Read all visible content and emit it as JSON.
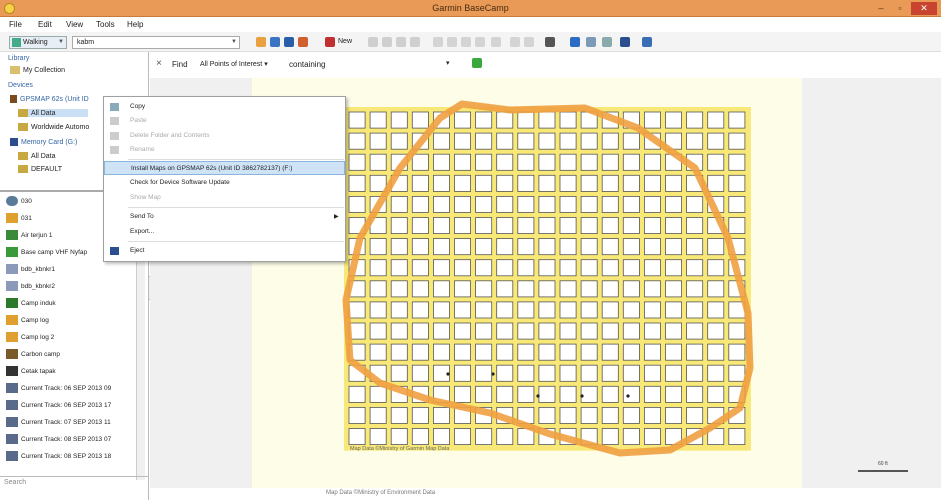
{
  "window": {
    "title": "Garmin BaseCamp",
    "min": "–",
    "max": "▫",
    "close": "✕"
  },
  "menu": [
    "File",
    "Edit",
    "View",
    "Tools",
    "Help"
  ],
  "toolbar": {
    "profile": "Walking",
    "activity": "kabm",
    "new_label": "New"
  },
  "sidebar": {
    "library_heading": "Library",
    "my_collection": "My Collection",
    "devices_heading": "Devices",
    "device_name": "GPSMAP 62s (Unit ID",
    "all_data": "All Data",
    "worldwide": "Worldwide Automo",
    "memory_card": "Memory Card (G:)",
    "card_all_data": "All Data",
    "card_default": "DEFAULT"
  },
  "list_items": [
    {
      "label": "030",
      "icon": "waypoint-icon"
    },
    {
      "label": "031",
      "icon": "cross-marker-icon"
    },
    {
      "label": "Air terjun 1",
      "icon": "waterfall-icon"
    },
    {
      "label": "Base camp VHF Nyfap",
      "icon": "flag-icon"
    },
    {
      "label": "bdb_kbnkr1",
      "icon": "vehicle-icon"
    },
    {
      "label": "bdb_kbnkr2",
      "icon": "vehicle-icon"
    },
    {
      "label": "Camp induk",
      "icon": "tent-icon"
    },
    {
      "label": "Camp log",
      "icon": "cross-marker-icon"
    },
    {
      "label": "Camp log 2",
      "icon": "cross-marker-icon"
    },
    {
      "label": "Carbon camp",
      "icon": "tree-icon"
    },
    {
      "label": "Cetak tapak",
      "icon": "footprint-icon"
    },
    {
      "label": "Current Track: 06 SEP 2013 09",
      "icon": "track-icon"
    },
    {
      "label": "Current Track: 06 SEP 2013 17",
      "icon": "track-icon"
    },
    {
      "label": "Current Track: 07 SEP 2013 11",
      "icon": "track-icon"
    },
    {
      "label": "Current Track: 08 SEP 2013 07",
      "icon": "track-icon"
    },
    {
      "label": "Current Track: 08 SEP 2013 18",
      "icon": "track-icon"
    }
  ],
  "search_placeholder": "Search",
  "findbar": {
    "close": "×",
    "find": "Find",
    "scope": "All Points of Interest",
    "containing": "containing"
  },
  "context_menu": {
    "copy": "Copy",
    "paste": "Paste",
    "delete": "Delete Folder and Contents",
    "rename": "Rename",
    "install_maps": "Install Maps on GPSMAP 62s (Unit ID 3862782137) (F:)",
    "check_update": "Check for Device Software Update",
    "show_map": "Show Map",
    "send_to": "Send To",
    "export": "Export...",
    "eject": "Eject"
  },
  "map": {
    "credit": "Map Data ©Ministry of Garmin Map Data",
    "scale": "60 ft",
    "footer": "Map Data ©Ministry of Environment Data",
    "grid_cols": 19,
    "grid_rows": 16,
    "polygon_color": "#f0a040",
    "grid_fill": "#f8e878"
  }
}
